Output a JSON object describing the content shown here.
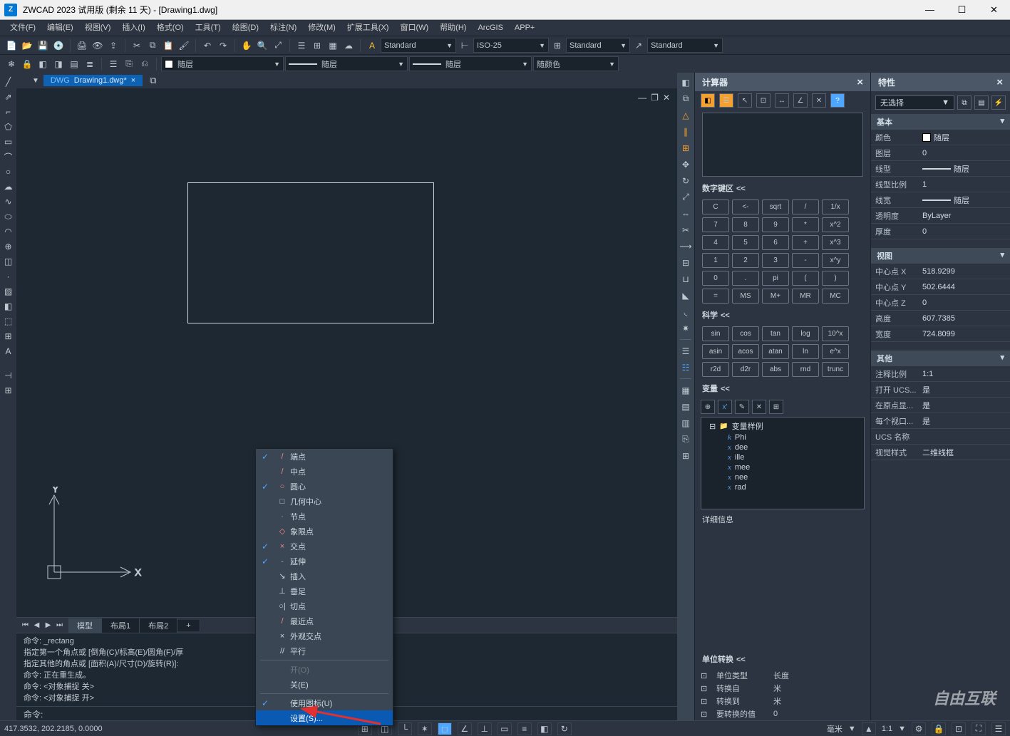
{
  "window": {
    "title": "ZWCAD 2023 试用版 (剩余 11 天) - [Drawing1.dwg]"
  },
  "menu": [
    "文件(F)",
    "编辑(E)",
    "视图(V)",
    "插入(I)",
    "格式(O)",
    "工具(T)",
    "绘图(D)",
    "标注(N)",
    "修改(M)",
    "扩展工具(X)",
    "窗口(W)",
    "帮助(H)",
    "ArcGIS",
    "APP+"
  ],
  "tb1": {
    "textstyle": "Standard",
    "dimstyle": "ISO-25",
    "tablestyle": "Standard",
    "mleaderstyle": "Standard"
  },
  "tb2": {
    "layer": "随层",
    "linetype": "随层",
    "lineweight": "随层",
    "plotstyle": "随颜色"
  },
  "doc": {
    "tab": "Drawing1.dwg*"
  },
  "btabs": [
    "模型",
    "布局1",
    "布局2"
  ],
  "cmd": {
    "l1": "命令: _rectang",
    "l2": "指定第一个角点或 [倒角(C)/标高(E)/圆角(F)/厚",
    "l3": "指定其他的角点或 [面积(A)/尺寸(D)/旋转(R)]:",
    "l4": "命令: 正在重生成。",
    "l5": "命令: <对象捕捉 关>",
    "l6": "命令: <对象捕捉 开>",
    "prompt": "命令: "
  },
  "ctx": {
    "items": [
      {
        "chk": "✓",
        "icon": "/",
        "label": "端点"
      },
      {
        "chk": "",
        "icon": "/",
        "label": "中点"
      },
      {
        "chk": "✓",
        "icon": "○",
        "label": "圆心"
      },
      {
        "chk": "",
        "icon": "□",
        "label": "几何中心"
      },
      {
        "chk": "",
        "icon": "·",
        "label": "节点"
      },
      {
        "chk": "",
        "icon": "◇",
        "label": "象限点"
      },
      {
        "chk": "✓",
        "icon": "×",
        "label": "交点"
      },
      {
        "chk": "✓",
        "icon": "-",
        "label": "延伸"
      },
      {
        "chk": "",
        "icon": "↘",
        "label": "插入"
      },
      {
        "chk": "",
        "icon": "⊥",
        "label": "垂足"
      },
      {
        "chk": "",
        "icon": "○|",
        "label": "切点"
      },
      {
        "chk": "",
        "icon": "/",
        "label": "最近点"
      },
      {
        "chk": "",
        "icon": "×",
        "label": "外观交点"
      },
      {
        "chk": "",
        "icon": "//",
        "label": "平行"
      }
    ],
    "open": "开(O)",
    "close": "关(E)",
    "usemarker": "使用图标(U)",
    "settings": "设置(S)..."
  },
  "calc": {
    "title": "计算器",
    "numhead": "数字键区",
    "keys": [
      [
        "C",
        "<-",
        "sqrt",
        "/",
        "1/x"
      ],
      [
        "7",
        "8",
        "9",
        "*",
        "x^2"
      ],
      [
        "4",
        "5",
        "6",
        "+",
        "x^3"
      ],
      [
        "1",
        "2",
        "3",
        "-",
        "x^y"
      ],
      [
        "0",
        ".",
        "pi",
        "(",
        ")"
      ],
      [
        "=",
        "MS",
        "M+",
        "MR",
        "MC"
      ]
    ],
    "scihead": "科学",
    "scikeys": [
      [
        "sin",
        "cos",
        "tan",
        "log",
        "10^x"
      ],
      [
        "asin",
        "acos",
        "atan",
        "ln",
        "e^x"
      ],
      [
        "r2d",
        "d2r",
        "abs",
        "rnd",
        "trunc"
      ]
    ],
    "varshead": "变量",
    "tree": {
      "root": "变量样例",
      "children": [
        "Phi",
        "dee",
        "ille",
        "mee",
        "nee",
        "rad"
      ]
    },
    "detail": "详细信息",
    "unithead": "单位转换",
    "unitrows": [
      [
        "单位类型",
        "长度"
      ],
      [
        "转换自",
        "米"
      ],
      [
        "转换到",
        "米"
      ],
      [
        "要转换的值",
        "0"
      ]
    ]
  },
  "props": {
    "title": "特性",
    "selector": "无选择",
    "groups": [
      {
        "head": "基本",
        "rows": [
          [
            "颜色",
            "随层",
            "color"
          ],
          [
            "图层",
            "0",
            ""
          ],
          [
            "线型",
            "随层",
            "line"
          ],
          [
            "线型比例",
            "1",
            ""
          ],
          [
            "线宽",
            "随层",
            "line"
          ],
          [
            "透明度",
            "ByLayer",
            ""
          ],
          [
            "厚度",
            "0",
            ""
          ]
        ]
      },
      {
        "head": "视图",
        "rows": [
          [
            "中心点 X",
            "518.9299",
            ""
          ],
          [
            "中心点 Y",
            "502.6444",
            ""
          ],
          [
            "中心点 Z",
            "0",
            ""
          ],
          [
            "高度",
            "607.7385",
            ""
          ],
          [
            "宽度",
            "724.8099",
            ""
          ]
        ]
      },
      {
        "head": "其他",
        "rows": [
          [
            "注释比例",
            "1:1",
            ""
          ],
          [
            "打开 UCS...",
            "是",
            ""
          ],
          [
            "在原点显...",
            "是",
            ""
          ],
          [
            "每个视口...",
            "是",
            ""
          ],
          [
            "UCS 名称",
            "",
            ""
          ],
          [
            "视觉样式",
            "二维线框",
            ""
          ]
        ]
      }
    ]
  },
  "status": {
    "coords": "417.3532, 202.2185, 0.0000",
    "scale": "1:1",
    "units": "毫米"
  },
  "watermark": "自由互联"
}
